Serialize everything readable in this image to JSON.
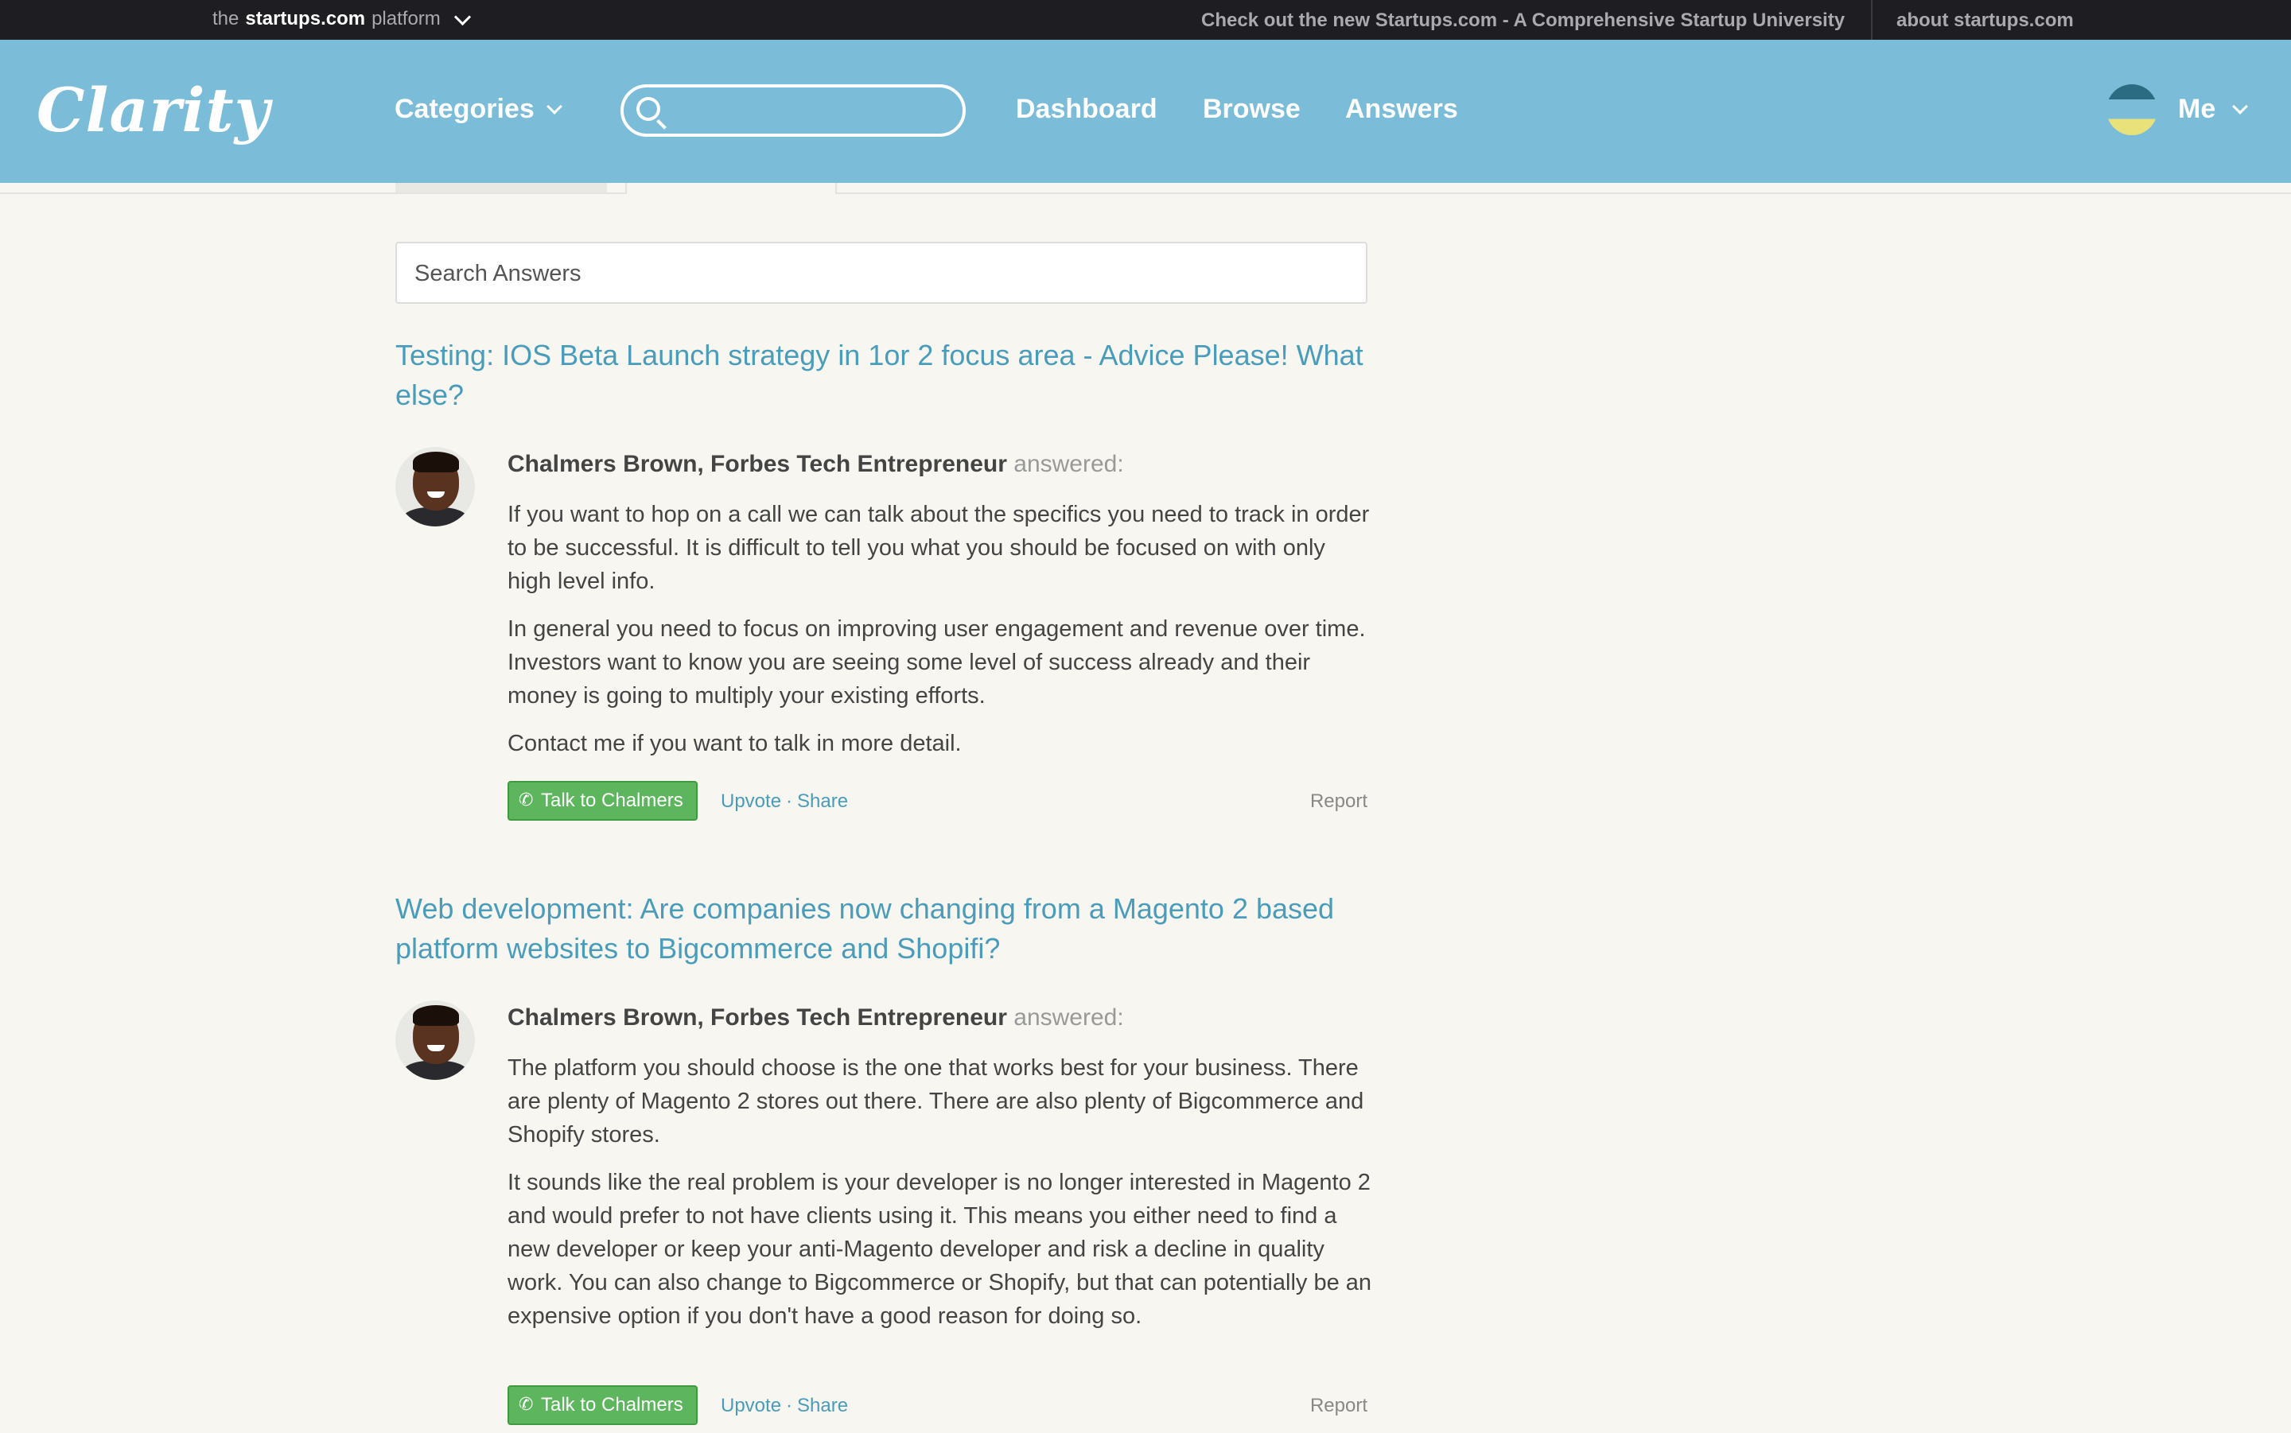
{
  "topbar": {
    "platform_prefix": "the",
    "platform_brand": "startups.com",
    "platform_suffix": "platform",
    "promo": "Check out the new Startups.com - A Comprehensive Startup University",
    "about": "about startups.com"
  },
  "header": {
    "logo": "Clarity",
    "categories": "Categories",
    "search_placeholder": "",
    "nav": [
      "Dashboard",
      "Browse",
      "Answers"
    ],
    "me": "Me"
  },
  "search_answers": {
    "placeholder": "Search Answers"
  },
  "questions": [
    {
      "title": "Testing: IOS Beta Launch strategy in 1or 2 focus area - Advice Please! What else?",
      "answerer": "Chalmers Brown, Forbes Tech Entrepreneur",
      "answered": "answered:",
      "paragraphs": [
        "If you want to hop on a call we can talk about the specifics you need to track in order to be successful. It is difficult to tell you what you should be focused on with only high level info.",
        "In general you need to focus on improving user engagement and revenue over time. Investors want to know you are seeing some level of success already and their money is going to multiply your existing efforts.",
        "Contact me if you want to talk in more detail."
      ],
      "talk_label": "Talk to Chalmers",
      "upvote": "Upvote",
      "share": "Share",
      "report": "Report"
    },
    {
      "title": "Web development: Are companies now changing from a Magento 2 based platform websites to Bigcommerce and Shopifi?",
      "answerer": "Chalmers Brown, Forbes Tech Entrepreneur",
      "answered": "answered:",
      "paragraphs": [
        "The platform you should choose is the one that works best for your business. There are plenty of Magento 2 stores out there. There are also plenty of Bigcommerce and Shopify stores.",
        "It sounds like the real problem is your developer is no longer interested in Magento 2 and would prefer to not have clients using it. This means you either need to find a new developer or keep your anti-Magento developer and risk a decline in quality work. You can also change to Bigcommerce or Shopify, but that can potentially be an expensive option if you don't have a good reason for doing so."
      ],
      "talk_label": "Talk to Chalmers",
      "upvote": "Upvote",
      "share": "Share",
      "report": "Report"
    }
  ],
  "colors": {
    "header_bg": "#7bbcd8",
    "topbar_bg": "#1d1d22",
    "link": "#4a9cbb",
    "talk_button": "#5db65d",
    "page_bg": "#f7f6f1"
  }
}
